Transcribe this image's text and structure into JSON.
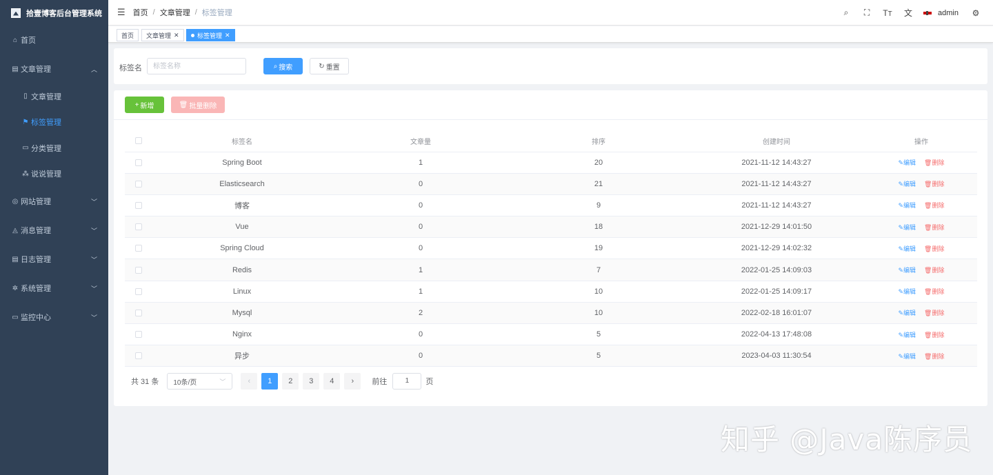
{
  "app": {
    "title": "拾壹博客后台管理系统"
  },
  "sidebar": {
    "items": [
      {
        "label": "首页",
        "icon": "home-icon"
      },
      {
        "label": "文章管理",
        "icon": "document-icon",
        "expanded": true,
        "children": [
          {
            "label": "文章管理",
            "icon": "file-icon"
          },
          {
            "label": "标签管理",
            "icon": "bookmark-icon",
            "active": true
          },
          {
            "label": "分类管理",
            "icon": "suitcase-icon"
          },
          {
            "label": "说说管理",
            "icon": "share-icon"
          }
        ]
      },
      {
        "label": "网站管理",
        "icon": "globe-icon"
      },
      {
        "label": "消息管理",
        "icon": "bell-icon"
      },
      {
        "label": "日志管理",
        "icon": "log-icon"
      },
      {
        "label": "系统管理",
        "icon": "gear-icon"
      },
      {
        "label": "监控中心",
        "icon": "monitor-icon"
      }
    ]
  },
  "header": {
    "breadcrumb": [
      "首页",
      "文章管理",
      "标签管理"
    ],
    "user": "admin",
    "tools": [
      "search-icon",
      "fullscreen-icon",
      "font-size-icon",
      "translate-icon",
      "flag-icon",
      "settings-icon"
    ]
  },
  "tags_view": [
    {
      "label": "首页",
      "closable": false
    },
    {
      "label": "文章管理",
      "closable": true
    },
    {
      "label": "标签管理",
      "closable": true,
      "active": true
    }
  ],
  "search": {
    "label": "标签名",
    "placeholder": "标签名称",
    "search_label": "搜索",
    "reset_label": "重置"
  },
  "toolbar": {
    "add_label": "新增",
    "batch_delete_label": "批量删除"
  },
  "table": {
    "columns": [
      "标签名",
      "文章量",
      "排序",
      "创建时间",
      "操作"
    ],
    "edit_label": "编辑",
    "delete_label": "删除",
    "rows": [
      {
        "name": "Spring Boot",
        "count": "1",
        "sort": "20",
        "created": "2021-11-12 14:43:27"
      },
      {
        "name": "Elasticsearch",
        "count": "0",
        "sort": "21",
        "created": "2021-11-12 14:43:27"
      },
      {
        "name": "博客",
        "count": "0",
        "sort": "9",
        "created": "2021-11-12 14:43:27"
      },
      {
        "name": "Vue",
        "count": "0",
        "sort": "18",
        "created": "2021-12-29 14:01:50"
      },
      {
        "name": "Spring Cloud",
        "count": "0",
        "sort": "19",
        "created": "2021-12-29 14:02:32"
      },
      {
        "name": "Redis",
        "count": "1",
        "sort": "7",
        "created": "2022-01-25 14:09:03"
      },
      {
        "name": "Linux",
        "count": "1",
        "sort": "10",
        "created": "2022-01-25 14:09:17"
      },
      {
        "name": "Mysql",
        "count": "2",
        "sort": "10",
        "created": "2022-02-18 16:01:07"
      },
      {
        "name": "Nginx",
        "count": "0",
        "sort": "5",
        "created": "2022-04-13 17:48:08"
      },
      {
        "name": "异步",
        "count": "0",
        "sort": "5",
        "created": "2023-04-03 11:30:54"
      }
    ]
  },
  "pagination": {
    "total": "共 31 条",
    "page_size": "10条/页",
    "pages": [
      "1",
      "2",
      "3",
      "4"
    ],
    "current": "1",
    "goto_label": "前往",
    "goto_value": "1",
    "goto_unit": "页"
  },
  "watermark": "知乎 @Java陈序员",
  "colors": {
    "sidebar": "#304156",
    "primary": "#409eff",
    "success": "#67c23a",
    "danger": "#f56c6c"
  }
}
